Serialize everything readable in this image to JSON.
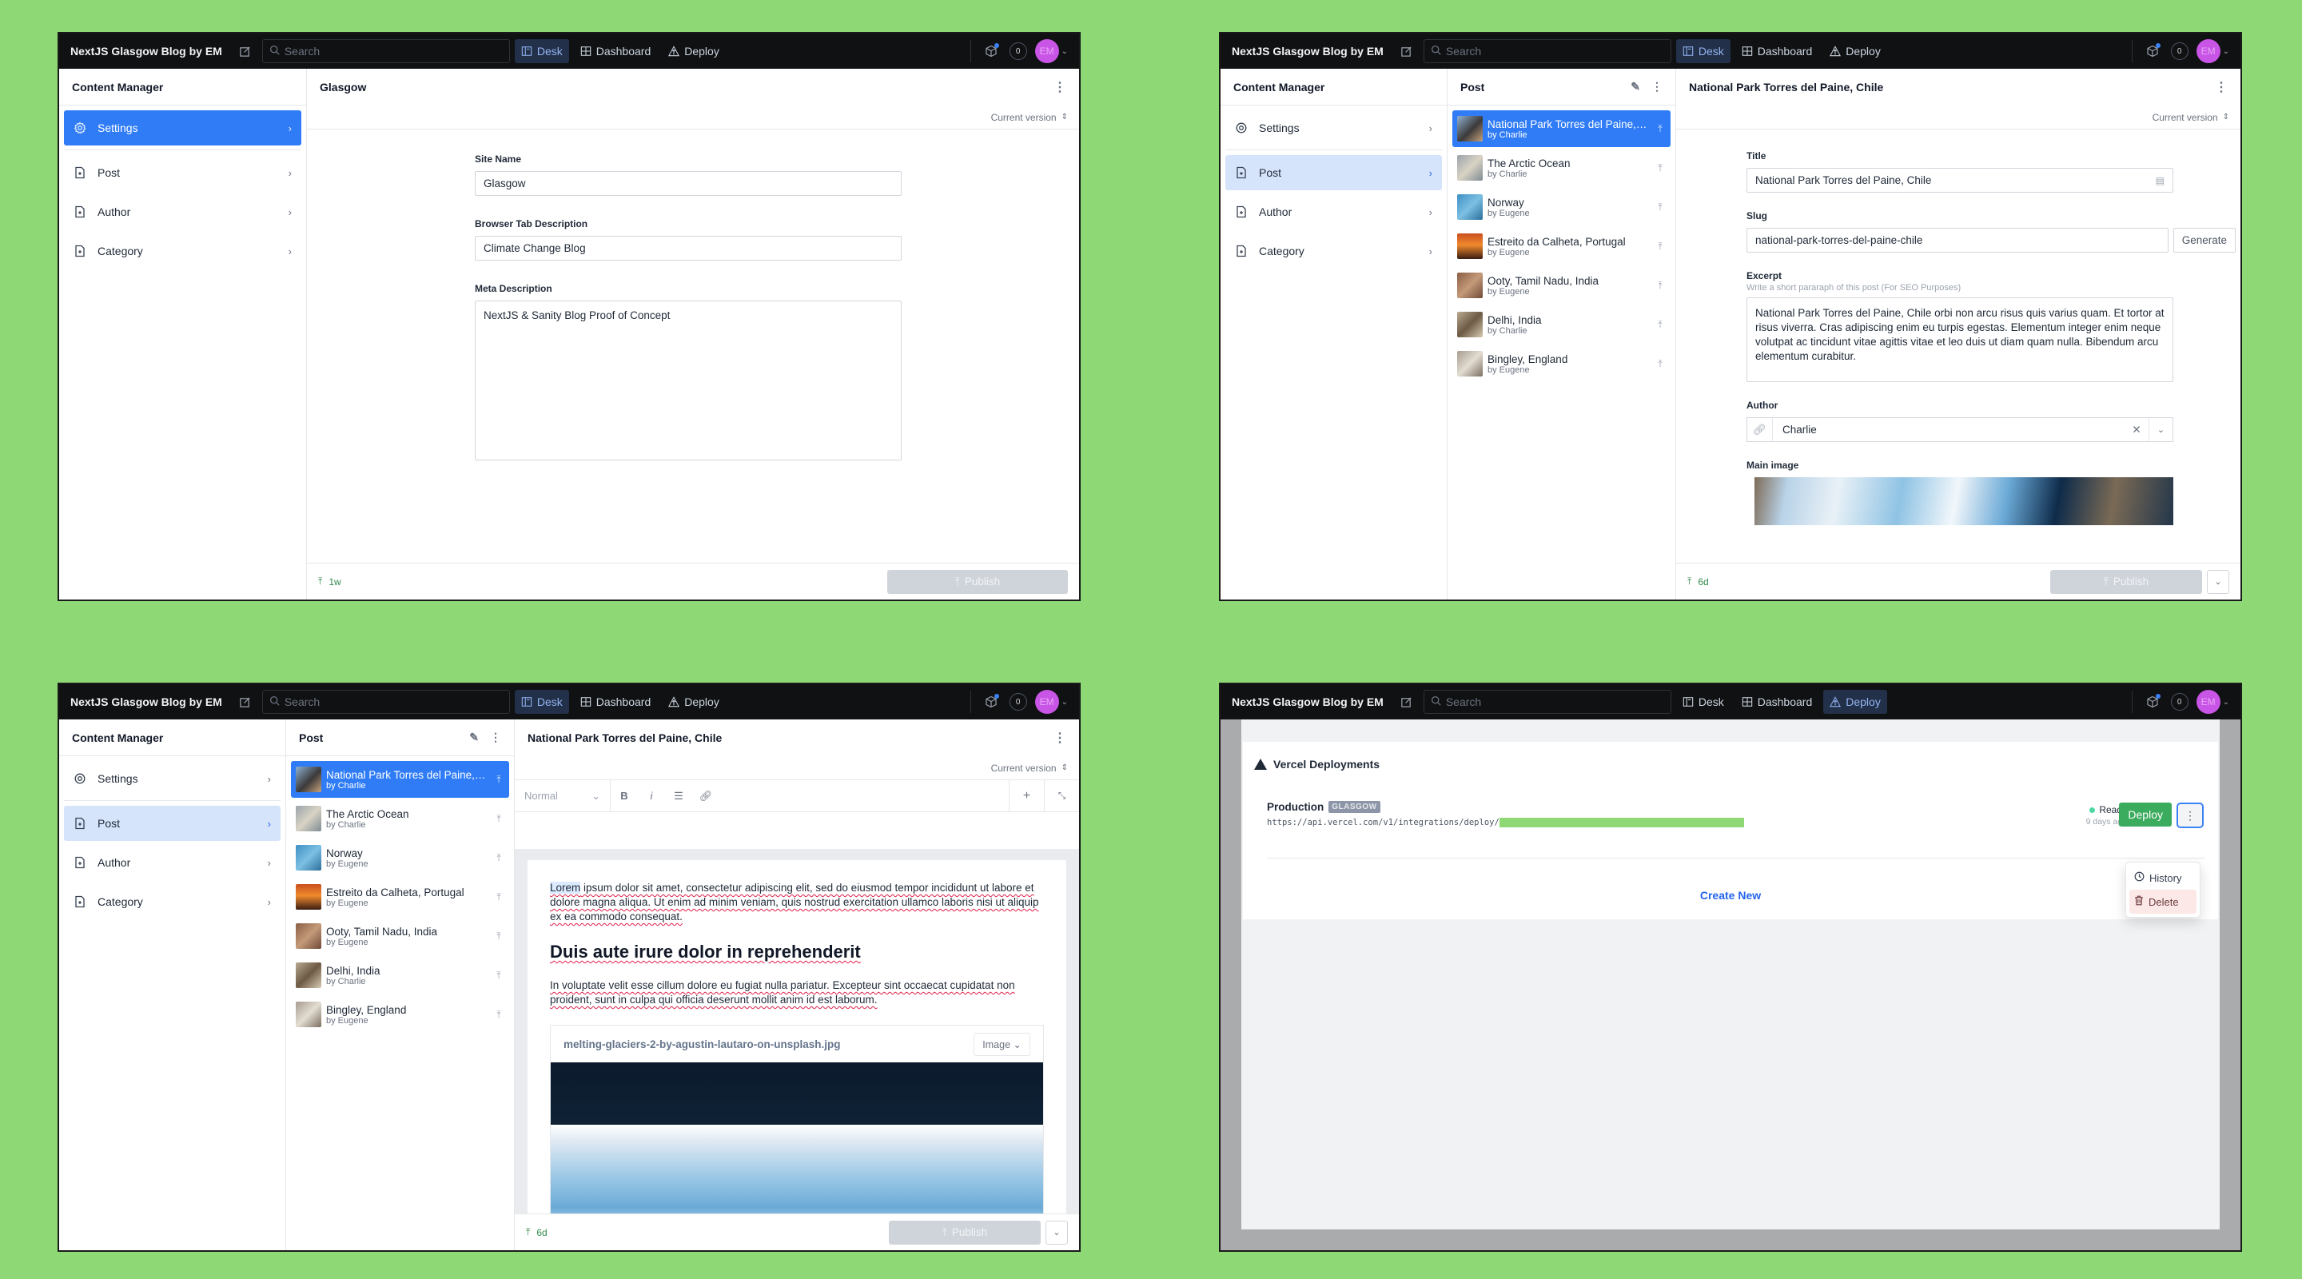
{
  "app": {
    "title": "NextJS Glasgow Blog by EM",
    "search_placeholder": "Search",
    "nav": [
      {
        "label": "Desk",
        "icon": "desk-icon"
      },
      {
        "label": "Dashboard",
        "icon": "dashboard-icon"
      },
      {
        "label": "Deploy",
        "icon": "deploy-icon"
      }
    ],
    "notification_count": "0",
    "avatar_initials": "EM"
  },
  "content_manager": {
    "title": "Content Manager",
    "items": [
      {
        "label": "Settings",
        "icon": "gear-icon"
      },
      {
        "label": "Post",
        "icon": "document-icon"
      },
      {
        "label": "Author",
        "icon": "document-icon"
      },
      {
        "label": "Category",
        "icon": "document-icon"
      }
    ]
  },
  "settings_doc": {
    "title": "Glasgow",
    "version_label": "Current version",
    "fields": {
      "site_name": {
        "label": "Site Name",
        "value": "Glasgow"
      },
      "browser_tab": {
        "label": "Browser Tab Description",
        "value": "Climate Change Blog"
      },
      "meta": {
        "label": "Meta Description",
        "value": "NextJS & Sanity Blog Proof of Concept"
      }
    },
    "last_published": "1w",
    "publish_label": "Publish"
  },
  "post_list": {
    "title": "Post",
    "items": [
      {
        "title": "National Park Torres del Paine, Chile",
        "author": "by Charlie"
      },
      {
        "title": "The Arctic Ocean",
        "author": "by Charlie"
      },
      {
        "title": "Norway",
        "author": "by Eugene"
      },
      {
        "title": "Estreito da Calheta, Portugal",
        "author": "by Eugene"
      },
      {
        "title": "Ooty, Tamil Nadu, India",
        "author": "by Eugene"
      },
      {
        "title": "Delhi, India",
        "author": "by Charlie"
      },
      {
        "title": "Bingley, England",
        "author": "by Eugene"
      }
    ]
  },
  "post_doc": {
    "title": "National Park Torres del Paine, Chile",
    "version_label": "Current version",
    "fields": {
      "title": {
        "label": "Title",
        "value": "National Park Torres del Paine, Chile"
      },
      "slug": {
        "label": "Slug",
        "value": "national-park-torres-del-paine-chile",
        "button": "Generate"
      },
      "excerpt": {
        "label": "Excerpt",
        "description": "Write a short pararaph of this post (For SEO Purposes)",
        "value": "National Park Torres del Paine, Chile orbi non arcu risus quis varius quam. Et tortor at risus viverra. Cras adipiscing enim eu turpis egestas. Elementum integer enim neque volutpat ac tincidunt vitae agittis vitae et leo duis ut diam quam nulla. Bibendum arcu elementum curabitur."
      },
      "author": {
        "label": "Author",
        "value": "Charlie"
      },
      "main_image": {
        "label": "Main image"
      }
    },
    "last_published": "6d",
    "publish_label": "Publish"
  },
  "editor": {
    "style_select": "Normal",
    "toolbar": [
      "bold",
      "italic",
      "bullet-list",
      "link"
    ],
    "paragraph1_lead": "Lorem",
    "paragraph1_rest": " ipsum dolor sit amet, consectetur adipiscing elit, sed do eiusmod tempor incididunt ut labore et dolore magna aliqua. Ut enim ad minim veniam, quis nostrud exercitation ullamco laboris nisi ut aliquip ex ea commodo consequat.",
    "heading": "Duis aute irure dolor in reprehenderit",
    "paragraph2": "In voluptate velit esse cillum dolore eu fugiat nulla pariatur. Excepteur sint occaecat cupidatat non proident, sunt in culpa qui officia deserunt mollit anim id est laborum.",
    "image_filename": "melting-glaciers-2-by-agustin-lautaro-on-unsplash.jpg",
    "image_type": "Image"
  },
  "deploy": {
    "title": "Vercel Deployments",
    "deployment": {
      "name": "Production",
      "badge": "GLASGOW",
      "url": "https://api.vercel.com/v1/integrations/deploy/",
      "status": "Ready",
      "status_color": "#4dd6a2",
      "time": "9 days ago",
      "deploy_label": "Deploy"
    },
    "menu": [
      {
        "label": "History",
        "icon": "clock-icon"
      },
      {
        "label": "Delete",
        "icon": "trash-icon"
      }
    ],
    "create_new": "Create New"
  },
  "colors": {
    "background": "#8ed975",
    "accent": "#2f7cf6",
    "deploy_green": "#3bab5d",
    "topbar": "#101112"
  }
}
